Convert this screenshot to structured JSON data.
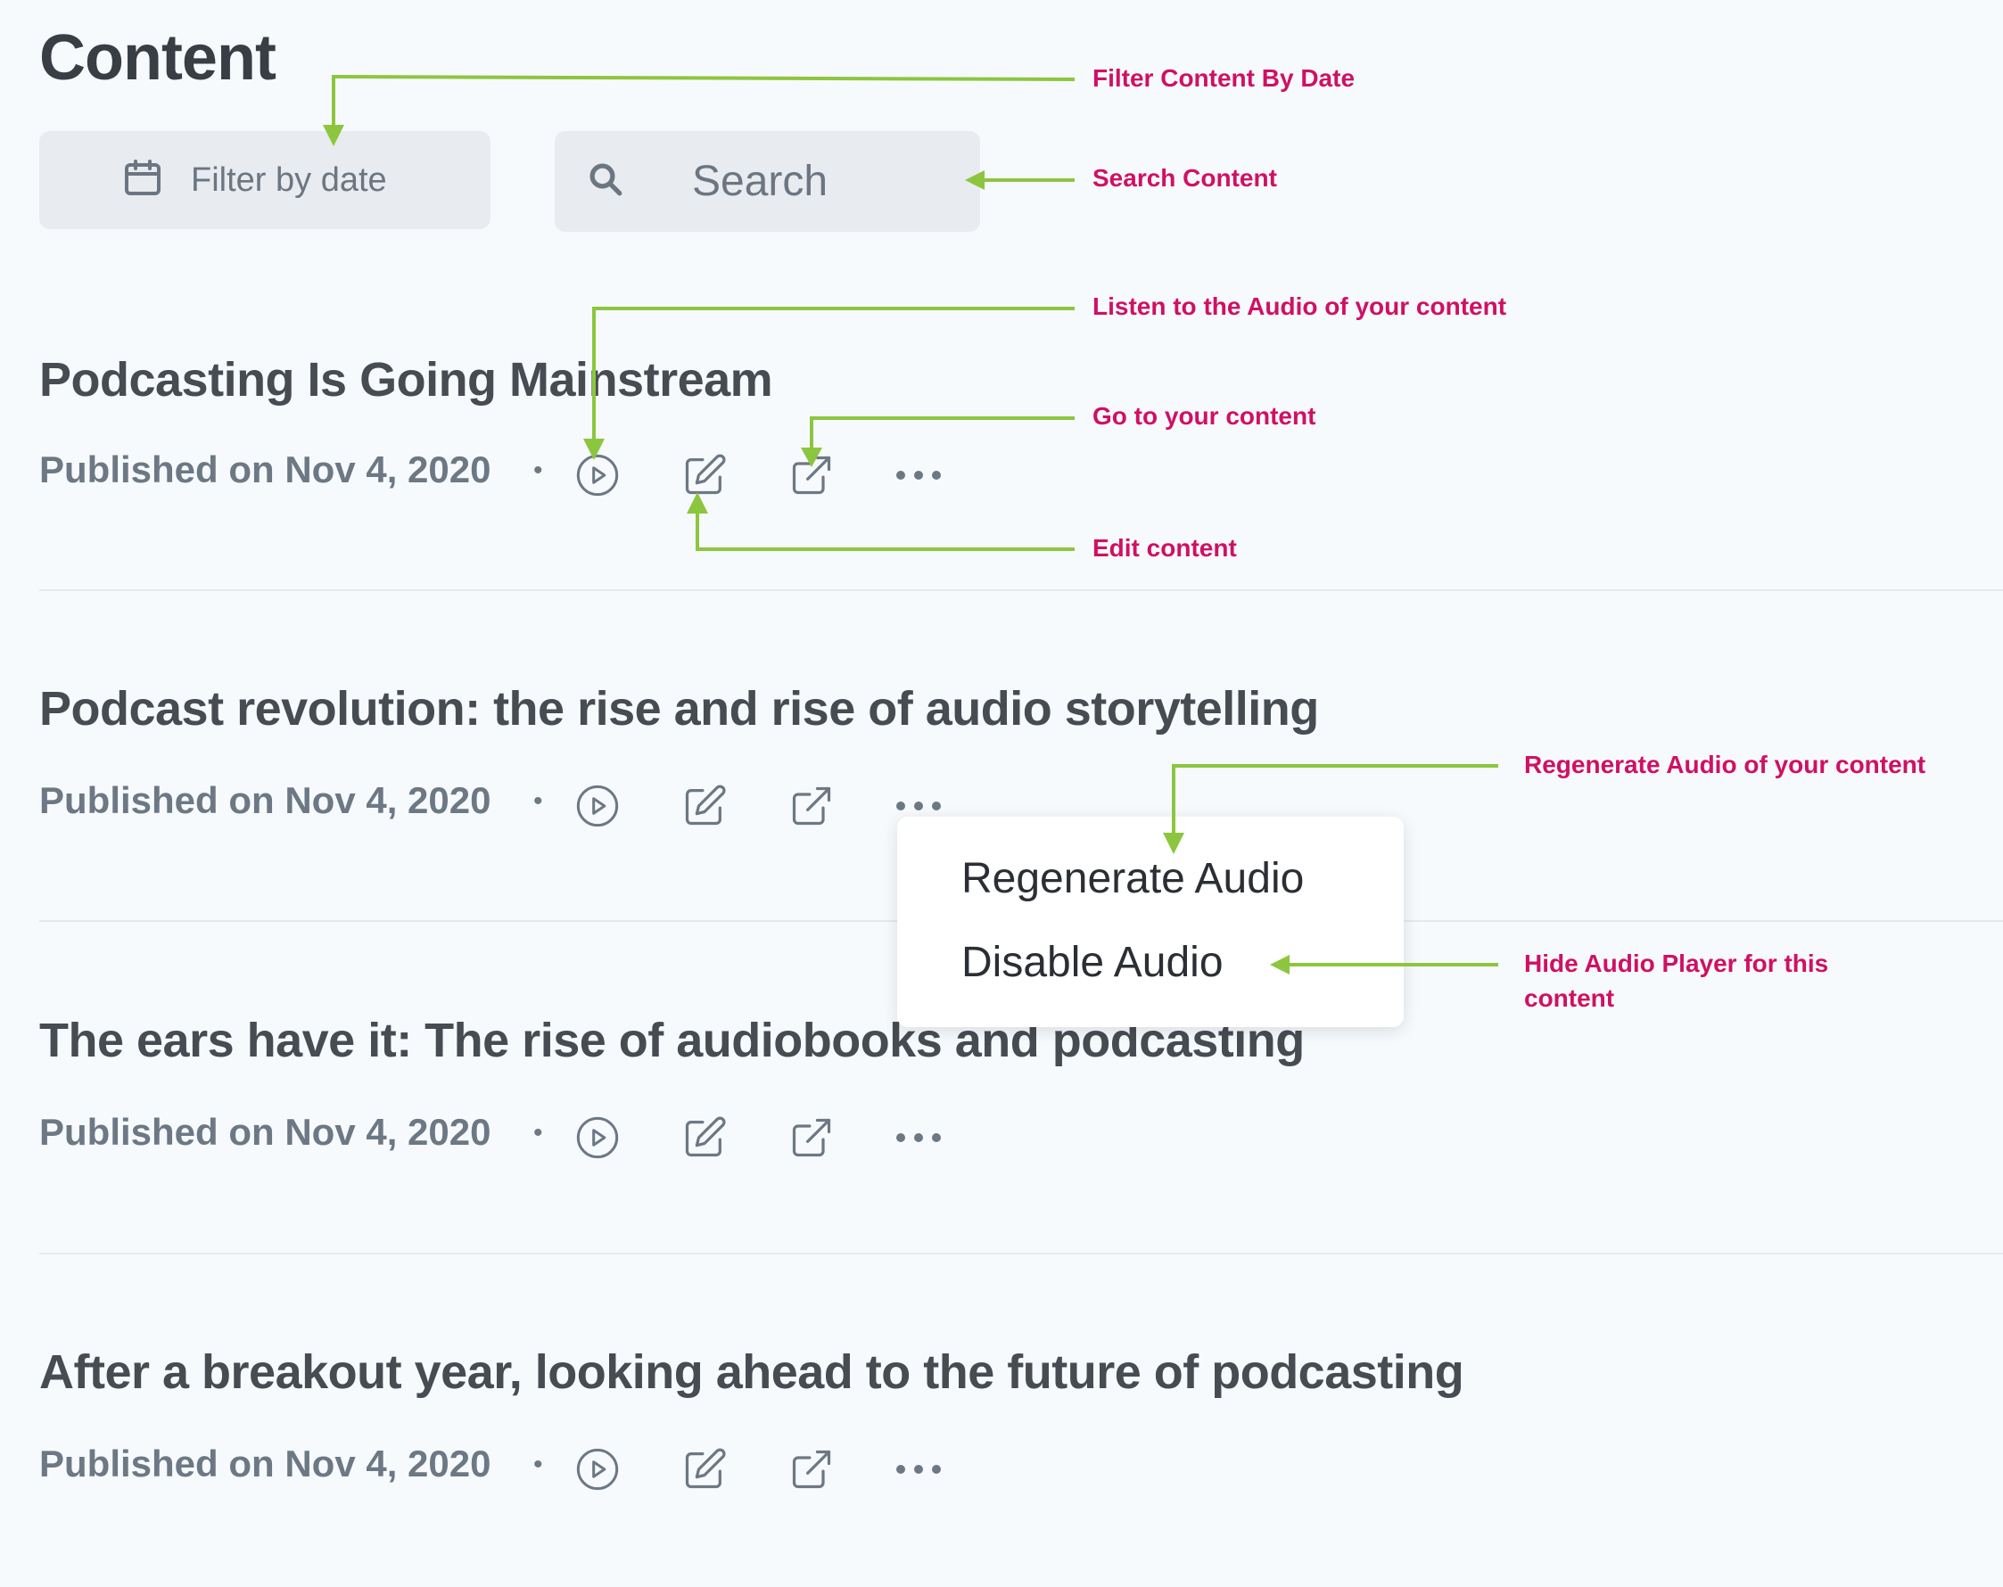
{
  "page": {
    "title": "Content"
  },
  "filter": {
    "label": "Filter by date"
  },
  "search": {
    "placeholder": "Search"
  },
  "items": [
    {
      "title": "Podcasting Is Going Mainstream",
      "published": "Published on Nov 4, 2020"
    },
    {
      "title": "Podcast revolution: the rise and rise of audio storytelling",
      "published": "Published on Nov 4, 2020"
    },
    {
      "title": "The ears have it: The rise of audiobooks and podcasting",
      "published": "Published on Nov 4, 2020"
    },
    {
      "title": "After a breakout year, looking ahead to the future of podcasting",
      "published": "Published on Nov 4, 2020"
    }
  ],
  "separator": "•",
  "menu": {
    "regenerate": "Regenerate Audio",
    "disable": "Disable Audio"
  },
  "annotations": {
    "filter": "Filter Content By Date",
    "search": "Search Content",
    "listen": "Listen to the Audio of your content",
    "goto": "Go to your content",
    "edit": "Edit content",
    "regenerate": "Regenerate Audio of your content",
    "hide_line1": "Hide Audio Player for this",
    "hide_line2": "content"
  },
  "colors": {
    "annotation_text": "#d01064",
    "annotation_arrow": "#8cc63f",
    "background": "#f7fafd"
  },
  "icons": [
    "calendar-icon",
    "search-icon",
    "play-circle-icon",
    "edit-icon",
    "external-link-icon",
    "more-dots-icon"
  ]
}
